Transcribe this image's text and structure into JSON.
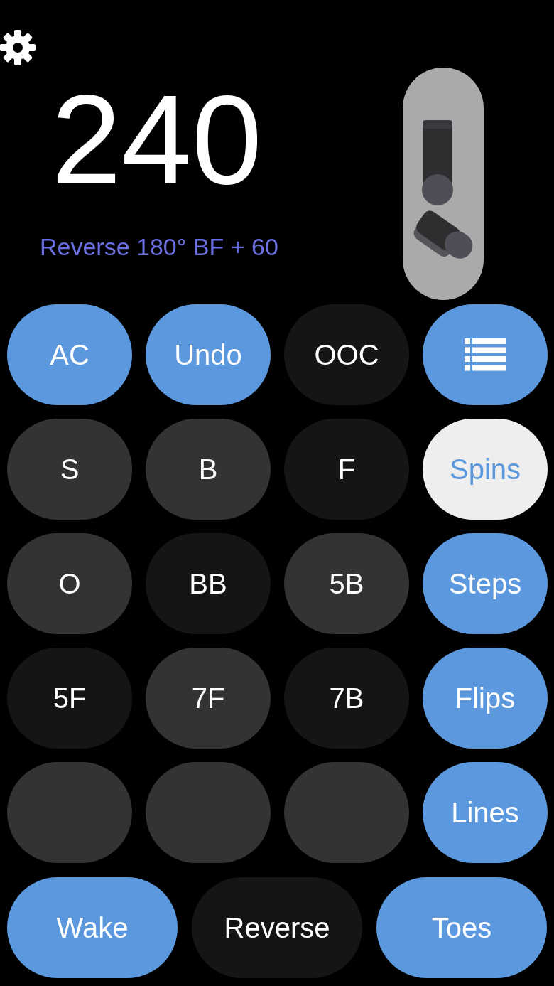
{
  "score": "240",
  "description": "Reverse 180° BF + 60",
  "keys": [
    {
      "kind": "text",
      "label": "AC",
      "color": "#5b98dd"
    },
    {
      "kind": "text",
      "label": "Undo",
      "color": "#5b98dd"
    },
    {
      "kind": "text",
      "label": "OOC",
      "color": "#151515"
    },
    {
      "kind": "icon",
      "color": "#5b98dd"
    },
    {
      "kind": "text",
      "label": "S",
      "color": "#333333"
    },
    {
      "kind": "text",
      "label": "B",
      "color": "#333333"
    },
    {
      "kind": "text",
      "label": "F",
      "color": "#151515"
    },
    {
      "kind": "text",
      "label": "Spins",
      "color": "#eeeeee"
    },
    {
      "kind": "text",
      "label": "O",
      "color": "#333333"
    },
    {
      "kind": "text",
      "label": "BB",
      "color": "#151515"
    },
    {
      "kind": "text",
      "label": "5B",
      "color": "#333333"
    },
    {
      "kind": "text",
      "label": "Steps",
      "color": "#5b98dd"
    },
    {
      "kind": "text",
      "label": "5F",
      "color": "#151515"
    },
    {
      "kind": "text",
      "label": "7F",
      "color": "#333333"
    },
    {
      "kind": "text",
      "label": "7B",
      "color": "#151515"
    },
    {
      "kind": "text",
      "label": "Flips",
      "color": "#5b98dd"
    },
    {
      "kind": "blank",
      "color": "#333333"
    },
    {
      "kind": "blank",
      "color": "#333333"
    },
    {
      "kind": "blank",
      "color": "#333333"
    },
    {
      "kind": "text",
      "label": "Lines",
      "color": "#5b98dd"
    }
  ],
  "bottom_keys": [
    {
      "kind": "text",
      "label": "Wake",
      "color": "#5b98dd"
    },
    {
      "kind": "text",
      "label": "Reverse",
      "color": "#151515"
    },
    {
      "kind": "text",
      "label": "Toes",
      "color": "#5b98dd"
    }
  ]
}
